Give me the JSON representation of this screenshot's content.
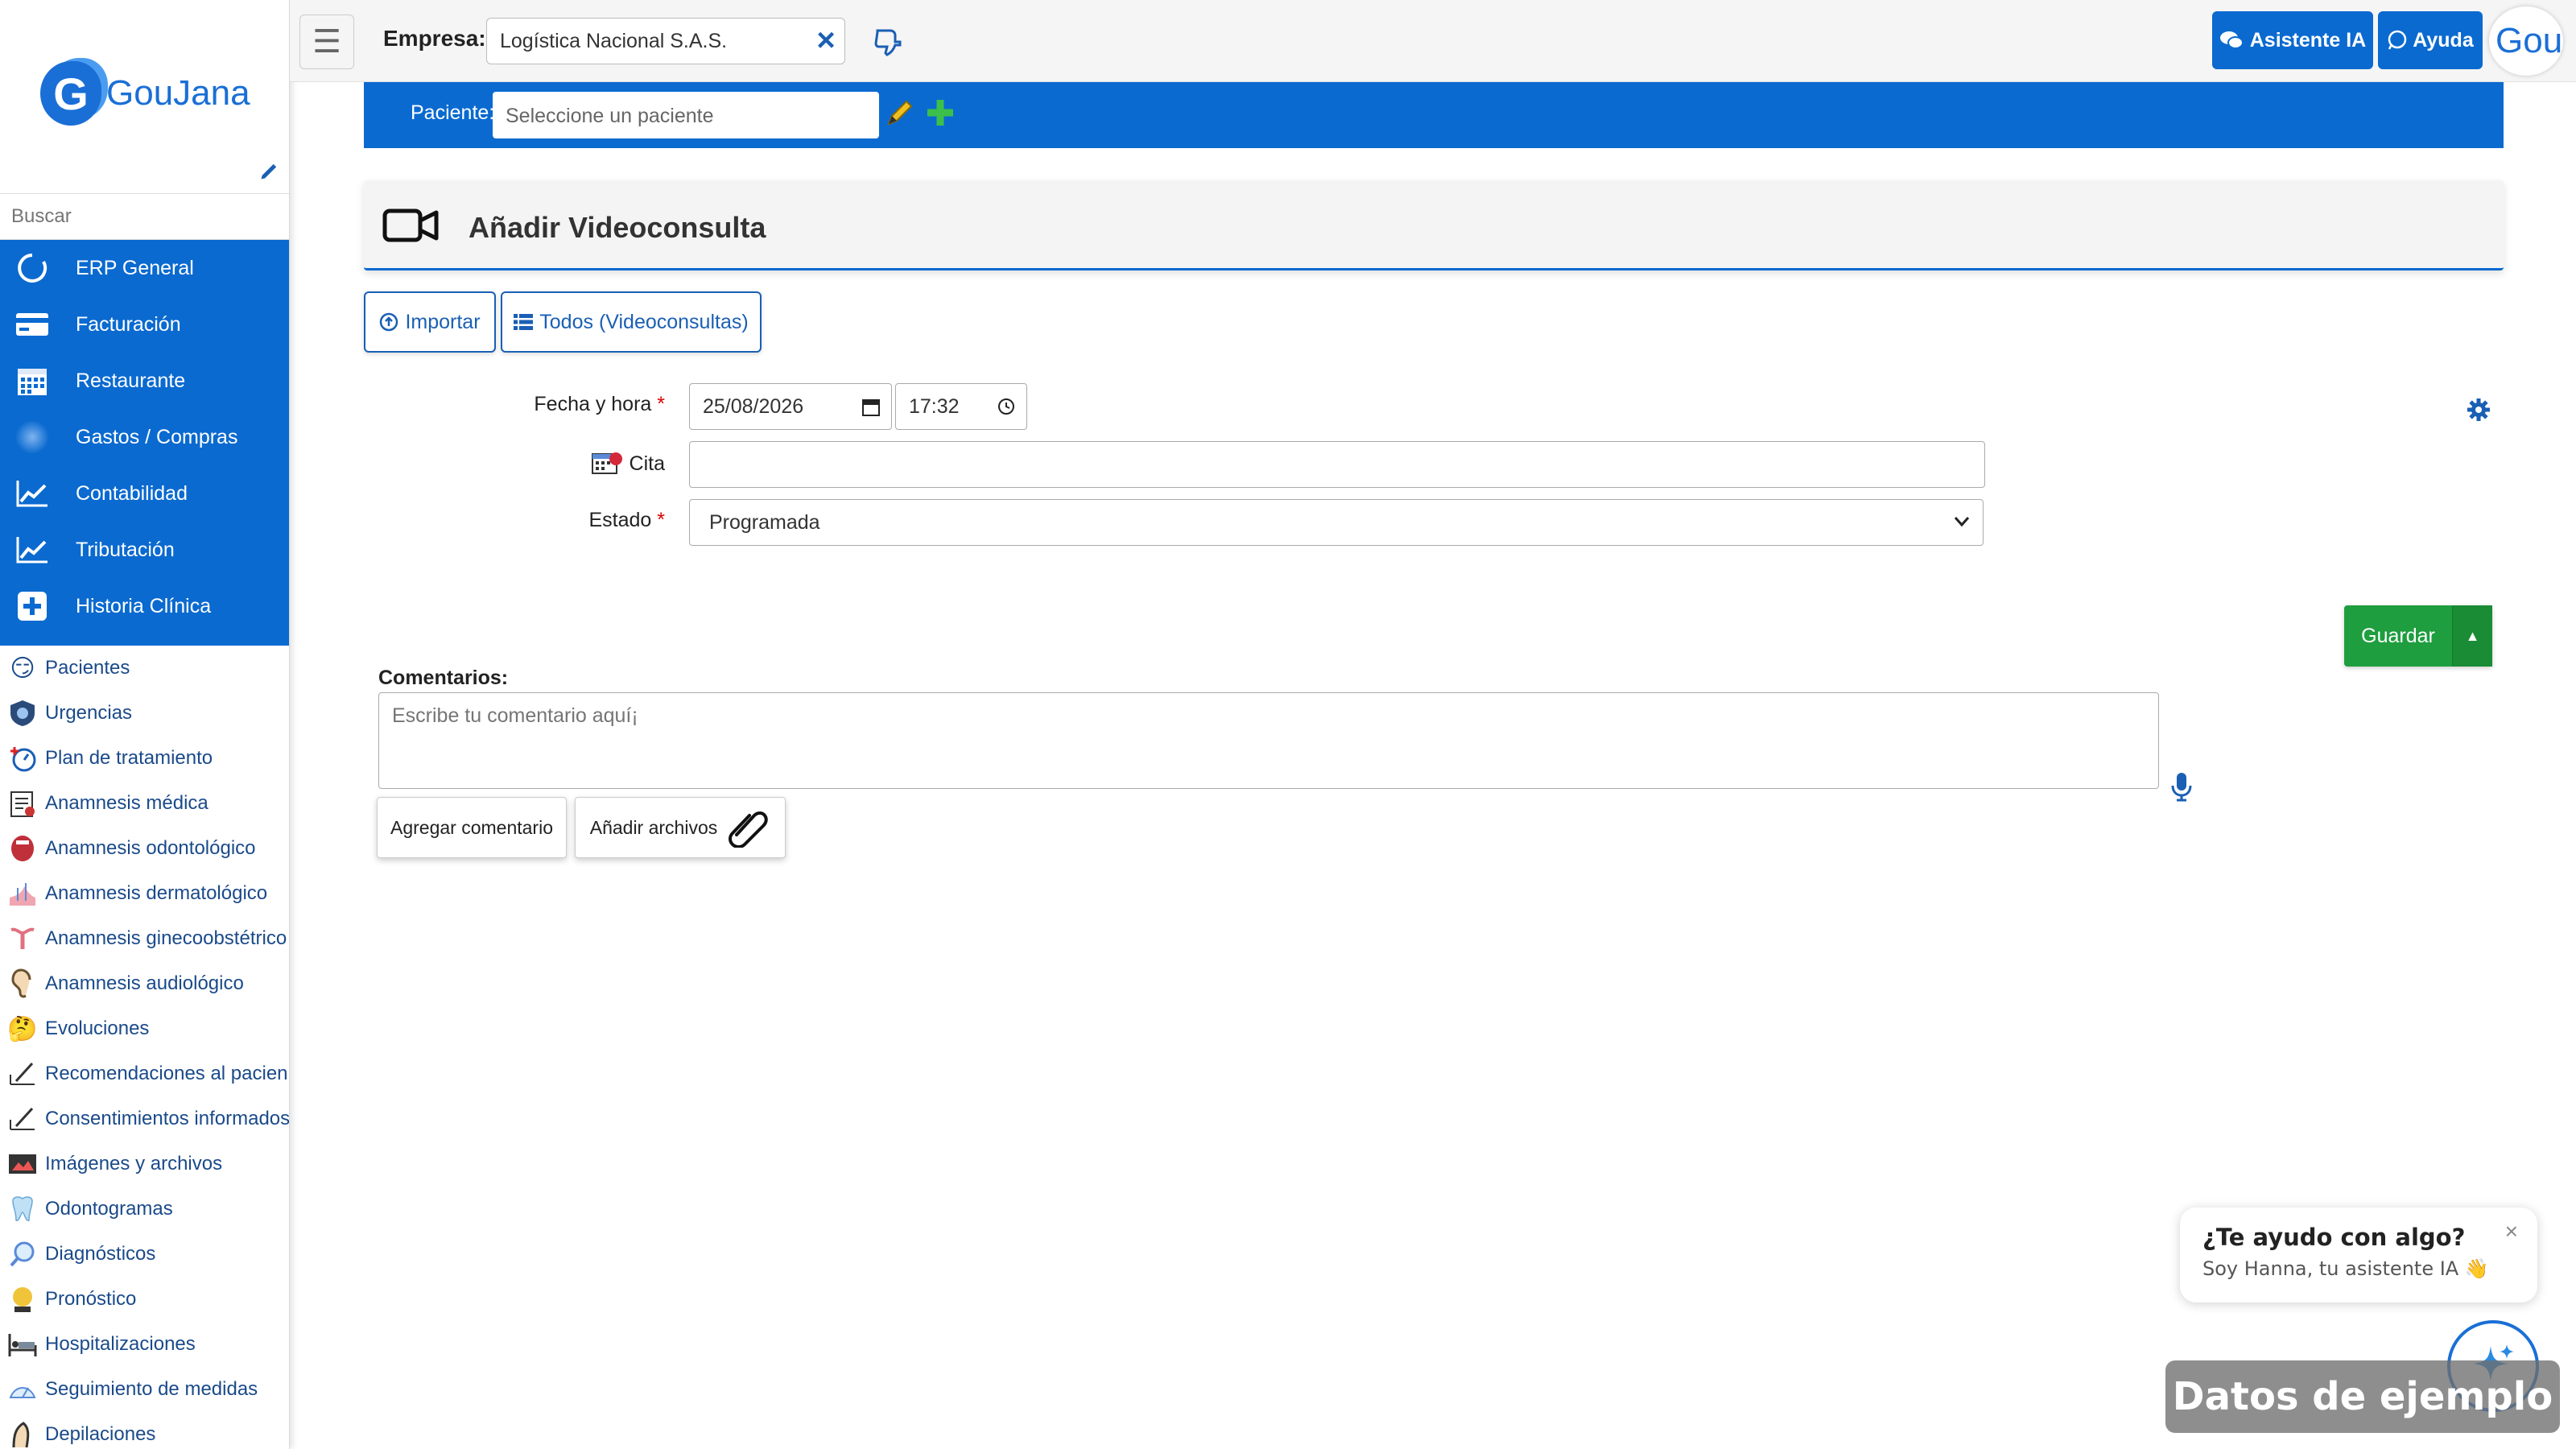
{
  "sidebar": {
    "logo_letter": "G",
    "logo_text": "GouJana",
    "search_placeholder": "Buscar",
    "modules": [
      {
        "label": "ERP General",
        "icon": "circle-loader-icon"
      },
      {
        "label": "Facturación",
        "icon": "credit-card-icon"
      },
      {
        "label": "Restaurante",
        "icon": "calendar-icon"
      },
      {
        "label": "Gastos / Compras",
        "icon": "blur-circle-icon"
      },
      {
        "label": "Contabilidad",
        "icon": "line-chart-icon"
      },
      {
        "label": "Tributación",
        "icon": "line-chart-icon"
      },
      {
        "label": "Historia Clínica",
        "icon": "plus-square-icon"
      }
    ],
    "sub_items": [
      {
        "label": "Pacientes",
        "icon": "patient-face-icon"
      },
      {
        "label": "Urgencias",
        "icon": "emergency-shield-icon"
      },
      {
        "label": "Plan de tratamiento",
        "icon": "treatment-plan-icon"
      },
      {
        "label": "Anamnesis médica",
        "icon": "medical-clipboard-icon"
      },
      {
        "label": "Anamnesis odontológico",
        "icon": "mouth-icon"
      },
      {
        "label": "Anamnesis dermatológico",
        "icon": "skin-icon"
      },
      {
        "label": "Anamnesis ginecoobstétrico",
        "icon": "uterus-icon"
      },
      {
        "label": "Anamnesis audiológico",
        "icon": "ear-icon"
      },
      {
        "label": "Evoluciones",
        "icon": "thinking-face-icon"
      },
      {
        "label": "Recomendaciones al pacien",
        "icon": "signature-icon"
      },
      {
        "label": "Consentimientos informados",
        "icon": "signature-icon"
      },
      {
        "label": "Imágenes y archivos",
        "icon": "images-icon"
      },
      {
        "label": "Odontogramas",
        "icon": "tooth-icon"
      },
      {
        "label": "Diagnósticos",
        "icon": "magnifier-icon"
      },
      {
        "label": "Pronóstico",
        "icon": "crystal-ball-icon"
      },
      {
        "label": "Hospitalizaciones",
        "icon": "hospital-bed-icon"
      },
      {
        "label": "Seguimiento de medidas",
        "icon": "scale-icon"
      },
      {
        "label": "Depilaciones",
        "icon": "depilation-icon"
      }
    ]
  },
  "topbar": {
    "empresa_label": "Empresa:",
    "empresa_value": "Logística Nacional S.A.S.",
    "btn_ia": "Asistente IA",
    "btn_ayuda": "Ayuda",
    "avatar_text": "Gou"
  },
  "patient": {
    "label": "Paciente:",
    "placeholder": "Seleccione un paciente"
  },
  "page": {
    "title": "Añadir Videoconsulta",
    "btn_import": "Importar",
    "btn_all": "Todos (Videoconsultas)"
  },
  "form": {
    "fecha_label": "Fecha y hora",
    "fecha_value": "25/08/2026",
    "hora_value": "17:32",
    "cita_label": "Cita",
    "cita_value": "",
    "estado_label": "Estado",
    "estado_value": "Programada",
    "required_mark": "*",
    "save_label": "Guardar"
  },
  "comments": {
    "label": "Comentarios:",
    "placeholder": "Escribe tu comentario aquí¡",
    "btn_add": "Agregar comentario",
    "btn_files": "Añadir archivos"
  },
  "assistant": {
    "title": "¿Te ayudo con algo?",
    "subtitle": "Soy Hanna, tu asistente IA 👋",
    "close": "×"
  },
  "watermark": "Datos de ejemplo",
  "colors": {
    "primary": "#0a6ad0",
    "success": "#1e9e3e",
    "required": "#dd0000"
  }
}
